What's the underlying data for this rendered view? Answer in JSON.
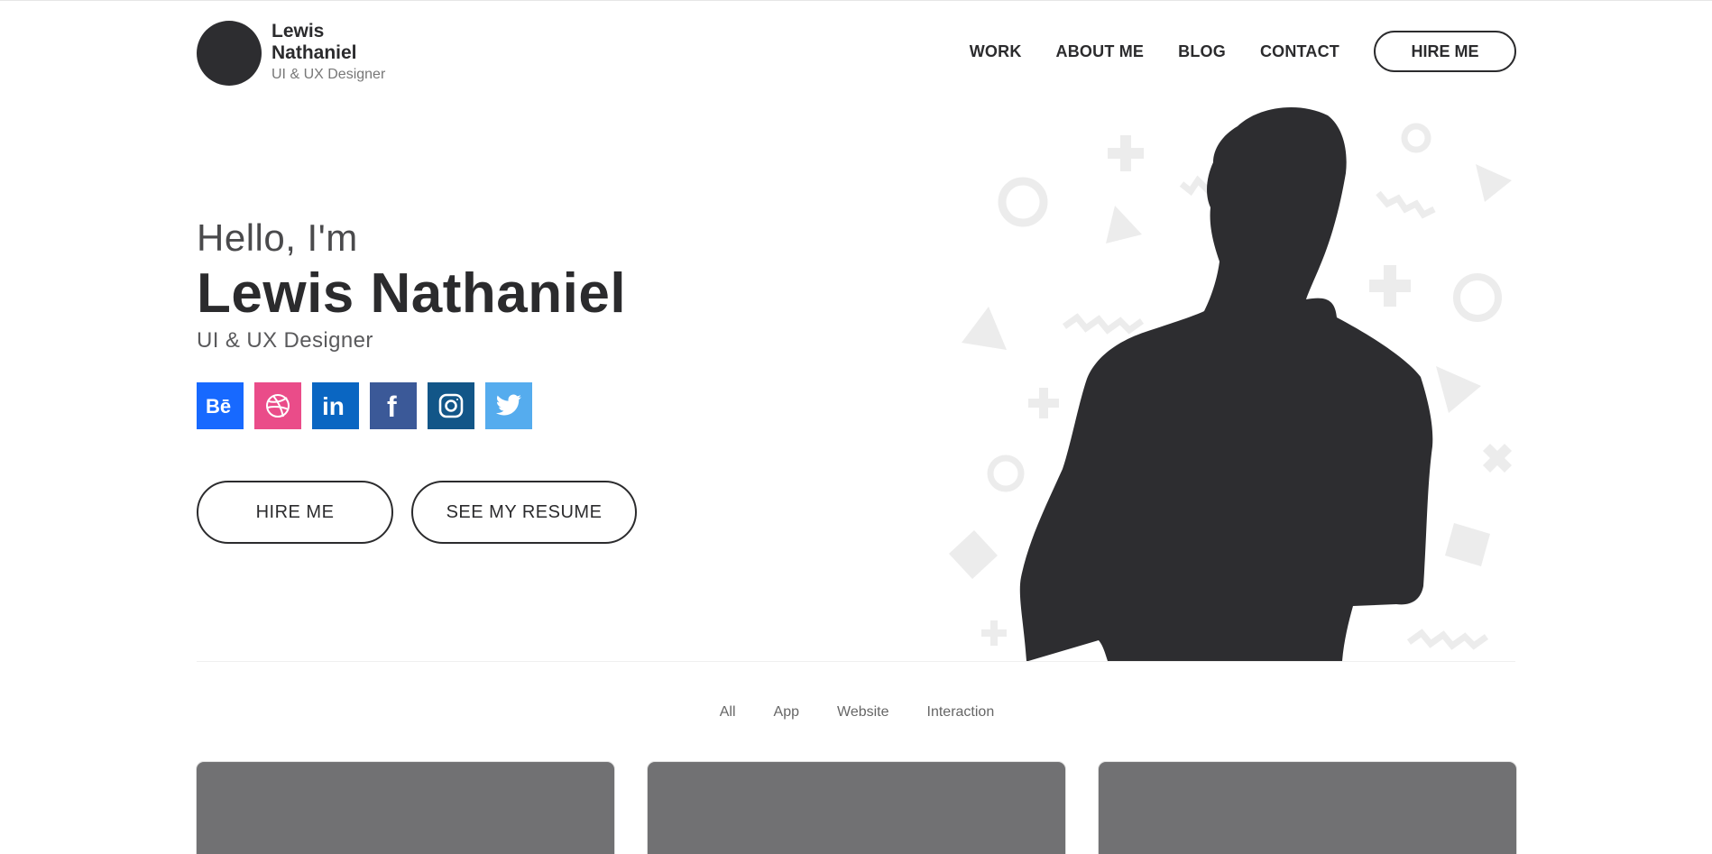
{
  "brand": {
    "name": "Lewis Nathaniel",
    "role": "UI & UX Designer"
  },
  "nav": {
    "items": [
      "WORK",
      "ABOUT ME",
      "BLOG",
      "CONTACT"
    ],
    "hire_label": "HIRE ME"
  },
  "hero": {
    "greeting": "Hello, I'm",
    "name": "Lewis Nathaniel",
    "role": "UI & UX Designer",
    "socials": [
      {
        "icon": "behance-icon",
        "color": "#1769ff"
      },
      {
        "icon": "dribbble-icon",
        "color": "#ea4c89"
      },
      {
        "icon": "linkedin-icon",
        "color": "#0a66c2"
      },
      {
        "icon": "facebook-icon",
        "color": "#3b5998"
      },
      {
        "icon": "instagram-icon",
        "color": "#125688"
      },
      {
        "icon": "twitter-icon",
        "color": "#55acee"
      }
    ],
    "buttons": {
      "hire": "HIRE ME",
      "resume": "SEE MY RESUME"
    }
  },
  "portfolio": {
    "filters": [
      "All",
      "App",
      "Website",
      "Interaction"
    ],
    "card_count": 3
  },
  "colors": {
    "text": "#2b2b2d",
    "silhouette": "#2d2d30",
    "shapes": "#ececec",
    "card": "#717173"
  }
}
